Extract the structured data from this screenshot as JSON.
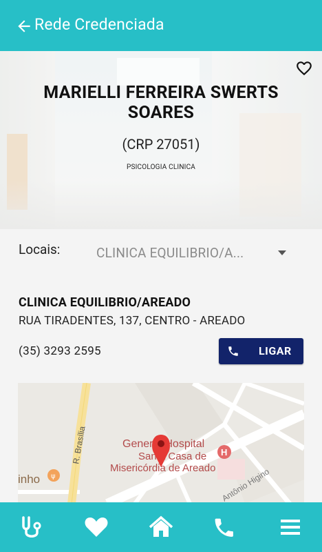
{
  "header": {
    "title": "Rede Credenciada",
    "back_icon": "arrow-left-icon"
  },
  "profile": {
    "name": "MARIELLI FERREIRA SWERTS SOARES",
    "registry": "(CRP 27051)",
    "specialty": "PSICOLOGIA CLINICA",
    "favorite_icon": "heart-outline-icon"
  },
  "locais": {
    "label": "Locais:",
    "selected": "CLINICA EQUILIBRIO/A..."
  },
  "clinic": {
    "name": "CLINICA EQUILIBRIO/AREADO",
    "address": "RUA TIRADENTES, 137, CENTRO - AREADO",
    "phone": "(35) 3293 2595",
    "call_label": "LIGAR"
  },
  "map": {
    "street_label": "R. Brasília",
    "poi_line1": "General Hospital",
    "poi_line2": "Santa Casa de",
    "poi_line3": "Misericórdia de Areado",
    "left_label": "inho",
    "street2_label": "Antônio Higino",
    "hospital_badge": "H"
  },
  "nav": {
    "items": [
      "stethoscope-icon",
      "heart-icon",
      "home-icon",
      "phone-icon",
      "menu-icon"
    ]
  },
  "colors": {
    "primary": "#27bfc7",
    "button": "#12236a",
    "pin": "#e53935"
  }
}
